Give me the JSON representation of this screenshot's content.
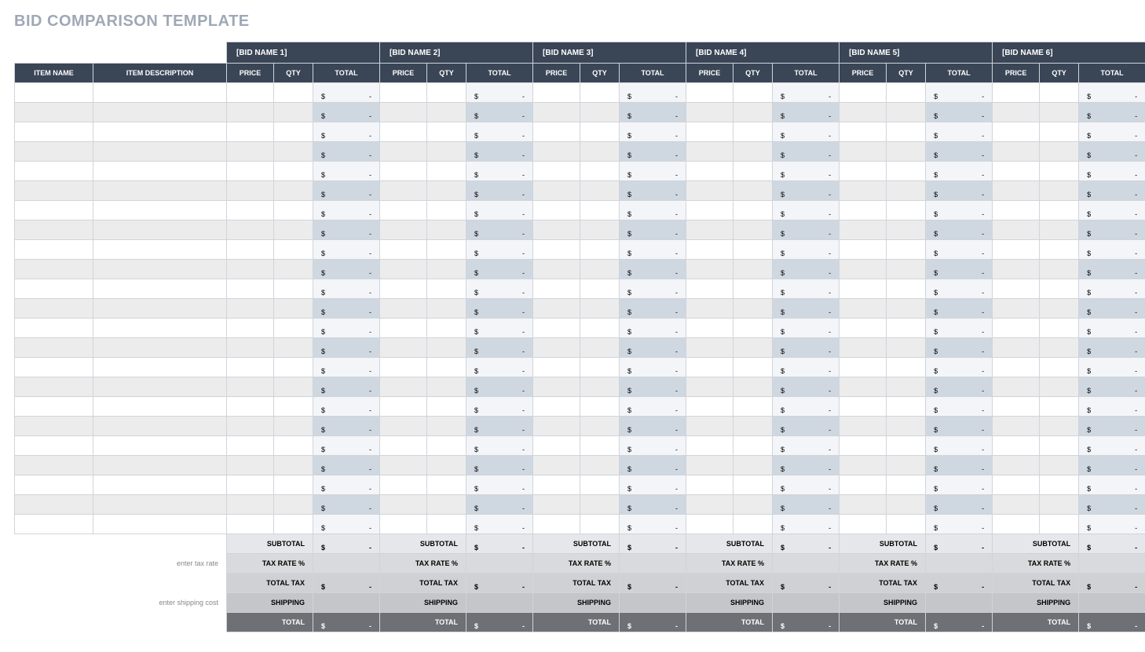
{
  "title": "BID COMPARISON TEMPLATE",
  "item_hdr": {
    "name": "ITEM NAME",
    "desc": "ITEM DESCRIPTION"
  },
  "col": {
    "price": "PRICE",
    "qty": "QTY",
    "total": "TOTAL"
  },
  "bids": [
    {
      "name": "[BID NAME 1]"
    },
    {
      "name": "[BID NAME 2]"
    },
    {
      "name": "[BID NAME 3]"
    },
    {
      "name": "[BID NAME 4]"
    },
    {
      "name": "[BID NAME 5]"
    },
    {
      "name": "[BID NAME 6]"
    }
  ],
  "rows": 23,
  "cur": "$",
  "dash": "-",
  "foot": {
    "subtotal": "SUBTOTAL",
    "taxrate_hint": "enter tax rate",
    "taxrate": "TAX RATE %",
    "totaltax": "TOTAL TAX",
    "ship_hint": "enter shipping cost",
    "shipping": "SHIPPING",
    "total": "TOTAL"
  }
}
